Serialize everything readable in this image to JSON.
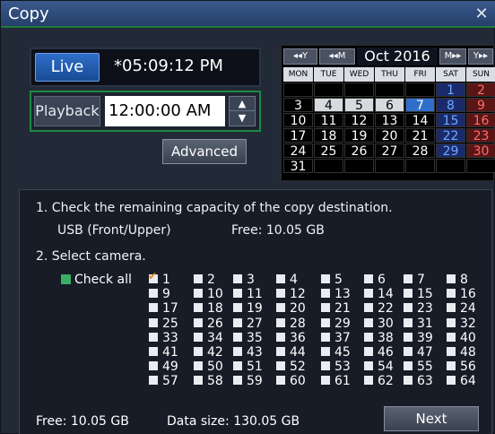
{
  "window": {
    "title": "Copy",
    "close_symbol": "✕"
  },
  "live": {
    "button_label": "Live",
    "time": "*05:09:12 PM"
  },
  "playback": {
    "label": "Playback",
    "time": "12:00:00 AM",
    "spin_up": "▲",
    "spin_down": "▼"
  },
  "advanced_label": "Advanced",
  "calendar": {
    "prev_year": "◂◂Y",
    "prev_month": "◂◂M",
    "month_label": "Oct 2016",
    "next_month": "M▸▸",
    "next_year": "Y▸▸",
    "weekdays": [
      "MON",
      "TUE",
      "WED",
      "THU",
      "FRI",
      "SAT",
      "SUN"
    ],
    "weeks": [
      [
        "",
        "",
        "",
        "",
        "",
        "1",
        "2"
      ],
      [
        "3",
        "4",
        "5",
        "6",
        "7",
        "8",
        "9"
      ],
      [
        "10",
        "11",
        "12",
        "13",
        "14",
        "15",
        "16"
      ],
      [
        "17",
        "18",
        "19",
        "20",
        "21",
        "22",
        "23"
      ],
      [
        "24",
        "25",
        "26",
        "27",
        "28",
        "29",
        "30"
      ],
      [
        "31",
        "",
        "",
        "",
        "",
        "",
        ""
      ]
    ],
    "selected_day": "7",
    "recorded_days": [
      "4",
      "5",
      "6"
    ]
  },
  "steps": {
    "step1": "1. Check the remaining capacity of the copy destination.",
    "usb_device": "USB (Front/Upper)",
    "usb_free": "Free: 10.05 GB",
    "step2": "2. Select camera.",
    "check_all": "Check all"
  },
  "cameras": {
    "labels": [
      "1",
      "2",
      "3",
      "4",
      "5",
      "6",
      "7",
      "8",
      "9",
      "10",
      "11",
      "12",
      "13",
      "14",
      "15",
      "16",
      "17",
      "18",
      "19",
      "20",
      "21",
      "22",
      "23",
      "24",
      "25",
      "26",
      "27",
      "28",
      "29",
      "30",
      "31",
      "32",
      "33",
      "34",
      "35",
      "36",
      "37",
      "38",
      "39",
      "40",
      "41",
      "42",
      "43",
      "44",
      "45",
      "46",
      "47",
      "48",
      "49",
      "50",
      "51",
      "52",
      "53",
      "54",
      "55",
      "56",
      "57",
      "58",
      "59",
      "60",
      "61",
      "62",
      "63",
      "64"
    ],
    "checked": [
      "1"
    ]
  },
  "footer": {
    "free": "Free: 10.05 GB",
    "data_size": "Data size: 130.05 GB",
    "next_label": "Next"
  },
  "colors": {
    "title_bar": "#2e4c7c",
    "live_button": "#2f6fc9",
    "playback_border": "#1d8a44",
    "check_all_box": "#3aae64",
    "checkmark": "#e08a1e",
    "saturday": "#6fa8ff",
    "sunday": "#ff6b6b"
  }
}
